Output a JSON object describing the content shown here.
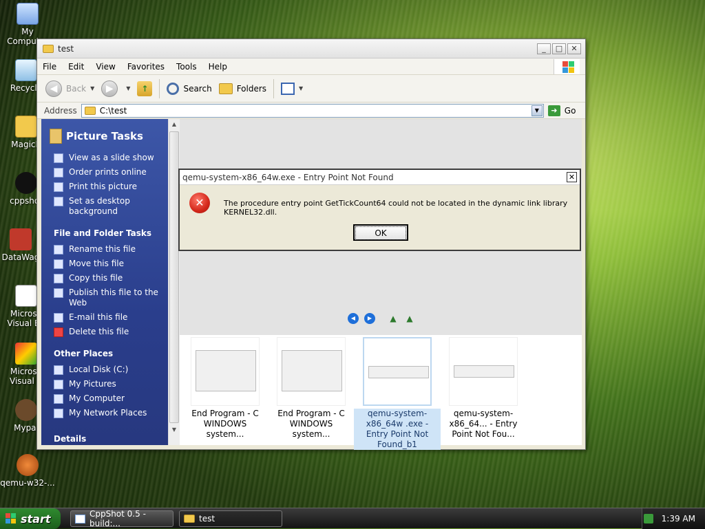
{
  "desktop": {
    "icons": [
      {
        "label": "My Computer",
        "icon": "my-computer-icon"
      },
      {
        "label": "Recycle",
        "icon": "recycle-bin-icon"
      },
      {
        "label": "MagicB",
        "icon": "folder-icon"
      },
      {
        "label": "cppshot",
        "icon": "cppshot-icon"
      },
      {
        "label": "DataWag",
        "icon": "shortcut-icon"
      },
      {
        "label": "Microso Visual Ba",
        "icon": "visual-basic-icon"
      },
      {
        "label": "Microso Visual C",
        "icon": "visual-c-icon"
      },
      {
        "label": "Mypai",
        "icon": "mypaint-icon"
      },
      {
        "label": "qemu-w32-...",
        "icon": "qemu-icon"
      }
    ]
  },
  "window": {
    "title": "test",
    "menu": [
      "File",
      "Edit",
      "View",
      "Favorites",
      "Tools",
      "Help"
    ],
    "toolbar": {
      "back": "Back",
      "search": "Search",
      "folders": "Folders"
    },
    "address": {
      "label": "Address",
      "value": "C:\\test",
      "go": "Go"
    },
    "left_pane": {
      "picture_tasks_title": "Picture Tasks",
      "picture_tasks": [
        "View as a slide show",
        "Order prints online",
        "Print this picture",
        "Set as desktop background"
      ],
      "file_tasks_title": "File and Folder Tasks",
      "file_tasks": [
        "Rename this file",
        "Move this file",
        "Copy this file",
        "Publish this file to the Web",
        "E-mail this file",
        "Delete this file"
      ],
      "other_places_title": "Other Places",
      "other_places": [
        "Local Disk (C:)",
        "My Pictures",
        "My Computer",
        "My Network Places"
      ],
      "details_title": "Details"
    },
    "thumbnails": [
      {
        "label": "End Program - C WINDOWS system...",
        "selected": false
      },
      {
        "label": "End Program - C WINDOWS system...",
        "selected": false
      },
      {
        "label": "qemu-system-x86_64w .exe - Entry Point Not Found_b1",
        "selected": true
      },
      {
        "label": "qemu-system-x86_64... - Entry Point Not Fou...",
        "selected": false
      }
    ]
  },
  "dialog": {
    "title": "qemu-system-x86_64w.exe - Entry Point Not Found",
    "message": "The procedure entry point GetTickCount64 could not be located in the dynamic link library KERNEL32.dll.",
    "ok": "OK"
  },
  "taskbar": {
    "start": "start",
    "buttons": [
      "CppShot 0.5 - build:...",
      "test"
    ],
    "clock": "1:39 AM"
  }
}
